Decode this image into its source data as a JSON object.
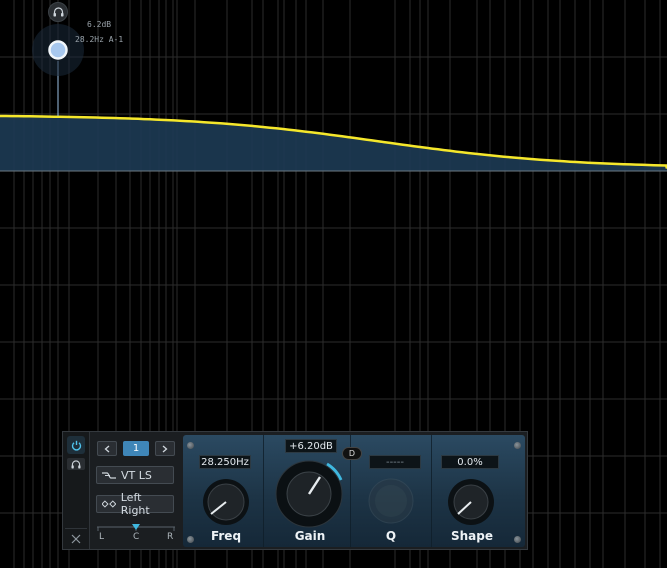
{
  "node": {
    "gain": "6.2dB",
    "freq_note": "28.2Hz A-1"
  },
  "band_panel": {
    "band_number": "1",
    "filter_type": "VT LS",
    "channel_mode": "Left Right",
    "pan_labels": {
      "left": "L",
      "center": "C",
      "right": "R"
    },
    "freq_value": "28.250Hz",
    "gain_value": "+6.20dB",
    "q_value": "-----",
    "shape_value": "0.0%",
    "freq_label": "Freq",
    "gain_label": "Gain",
    "q_label": "Q",
    "shape_label": "Shape",
    "dynamic_button": "D"
  },
  "colors": {
    "curve": "#f5e72b",
    "fill": "#1c3a52",
    "accent": "#3fb8e0",
    "node": "#a8c8ee"
  }
}
